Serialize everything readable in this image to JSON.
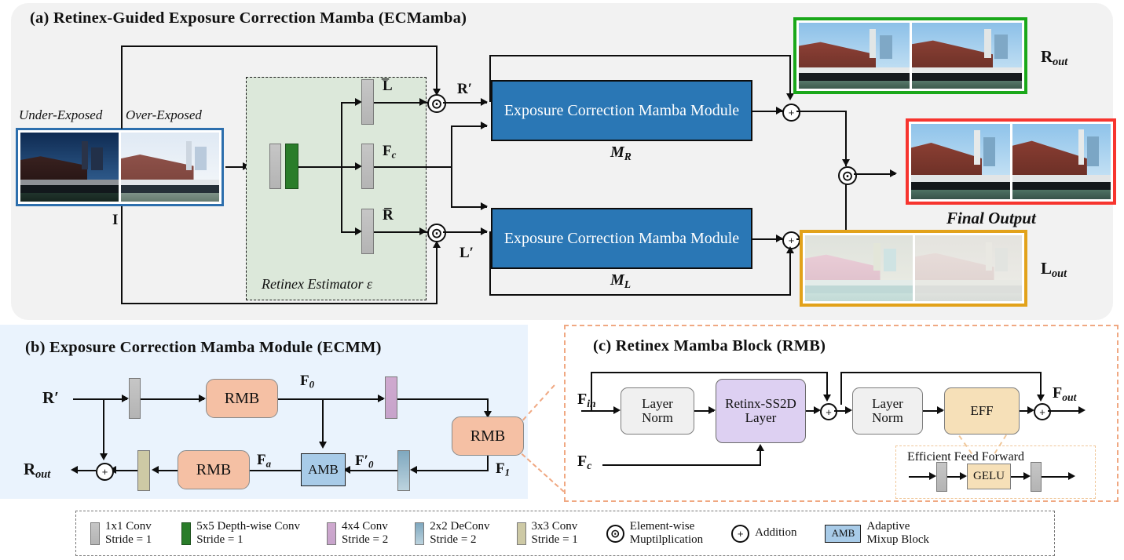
{
  "figure": {
    "panels": [
      {
        "id": "a",
        "title": "(a)  Retinex-Guided Exposure Correction Mamba (ECMamba)"
      },
      {
        "id": "b",
        "title": "(b)  Exposure Correction Mamba Module (ECMM)"
      },
      {
        "id": "c",
        "title": "(c)  Retinex Mamba Block (RMB)"
      }
    ]
  },
  "panel_a": {
    "input_caption_left": "Under-Exposed",
    "input_caption_right": "Over-Exposed",
    "input_label": "I",
    "retinex_box_label": "Retinex Estimator ε",
    "retinex_outputs": {
      "top": "L̅",
      "mid": "F",
      "mid_sub": "c",
      "bottom": "R̅"
    },
    "stream_labels": {
      "top": "R′",
      "bottom": "L′"
    },
    "modules": [
      {
        "name": "Exposure Correction Mamba Module",
        "sub": "M",
        "sub_idx": "R"
      },
      {
        "name": "Exposure Correction Mamba Module",
        "sub": "M",
        "sub_idx": "L"
      }
    ],
    "outputs": {
      "reflectance": "R",
      "reflectance_sub": "out",
      "illumination": "L",
      "illumination_sub": "out",
      "final": "Final Output"
    },
    "frame_colors": {
      "input": "#2d6fad",
      "reflectance": "#1aa81a",
      "final": "#f7352f",
      "illumination": "#e2a21a"
    }
  },
  "panel_b": {
    "input_label": "R′",
    "output_label": "R",
    "output_sub": "out",
    "blocks": [
      {
        "name": "RMB"
      },
      {
        "name": "RMB"
      },
      {
        "name": "RMB"
      },
      {
        "name": "AMB"
      }
    ],
    "tensor_labels": [
      {
        "base": "F",
        "sub": "0"
      },
      {
        "base": "F",
        "sub": "1"
      },
      {
        "base": "F′",
        "sub": "0"
      },
      {
        "base": "F",
        "sub": "a"
      }
    ]
  },
  "panel_c": {
    "input_label": "F",
    "input_sub": "in",
    "cond_label": "F",
    "cond_sub": "c",
    "output_label": "F",
    "output_sub": "out",
    "blocks": [
      {
        "name": "Layer\nNorm"
      },
      {
        "name": "Retinx-SS2D\nLayer"
      },
      {
        "name": "Layer\nNorm"
      },
      {
        "name": "EFF"
      }
    ],
    "eff_detail": {
      "title": "Efficient  Feed Forward",
      "activation": "GELU"
    }
  },
  "legend": {
    "items": [
      {
        "icon": "gray-bar-icon",
        "swatch": "#bdbdbd",
        "line1": "1x1 Conv",
        "line2": "Stride = 1"
      },
      {
        "icon": "green-bar-icon",
        "swatch": "#2a7d2a",
        "line1": "5x5 Depth-wise  Conv",
        "line2": "Stride = 1"
      },
      {
        "icon": "purple-bar-icon",
        "swatch": "#c9a5cc",
        "line1": "4x4 Conv",
        "line2": "Stride = 2"
      },
      {
        "icon": "blue-bar-icon",
        "swatch": "#9cc0d4",
        "line1": "2x2 DeConv",
        "line2": "Stride = 2"
      },
      {
        "icon": "olive-bar-icon",
        "swatch": "#cdc9a5",
        "line1": "3x3 Conv",
        "line2": "Stride = 1"
      },
      {
        "icon": "element-wise-multiplication-icon",
        "swatch": "",
        "line1": "Element-wise",
        "line2": "Muptilplication"
      },
      {
        "icon": "addition-icon",
        "swatch": "",
        "line1": "Addition",
        "line2": ""
      },
      {
        "icon": "amb-badge-icon",
        "swatch": "#a8cbe8",
        "badge": "AMB",
        "line1": "Adaptive",
        "line2": "Mixup  Block"
      }
    ]
  },
  "colors": {
    "panel_a_bg": "#f2f2f2",
    "panel_b_bg": "#eaf3fd",
    "module_blue": "#2a77b5",
    "rmb_peach": "#f5c0a4",
    "amb_blue": "#a8cbe8",
    "ss2d_purple": "#ddd0f2",
    "eff_tan": "#f6e0b8",
    "retinex_green": "#dce8da",
    "accent_dashed": "#f0a882"
  }
}
